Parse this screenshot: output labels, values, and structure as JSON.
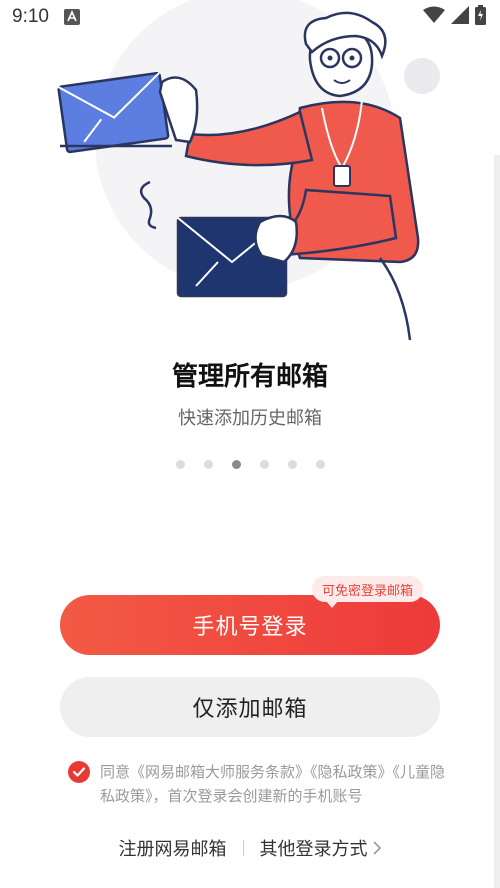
{
  "status_bar": {
    "time": "9:10",
    "icons": [
      "app-notification-icon",
      "wifi-icon",
      "signal-icon",
      "battery-icon"
    ]
  },
  "illustration": {
    "description_icon": "person-holding-envelopes-illustration",
    "colors": {
      "shirt": "#ef5a4c",
      "envelope_front": "#5b7ee0",
      "envelope_back": "#1f3570",
      "skin": "#ffffff"
    }
  },
  "onboarding": {
    "title": "管理所有邮箱",
    "subtitle": "快速添加历史邮箱",
    "page_count": 6,
    "active_page": 3
  },
  "actions": {
    "phone_login_label": "手机号登录",
    "tip_badge": "可免密登录邮箱",
    "add_mailbox_label": "仅添加邮箱"
  },
  "agreement": {
    "checked": true,
    "text": "同意《网易邮箱大师服务条款》《隐私政策》《儿童隐私政策》，首次登录会创建新的手机账号"
  },
  "footer": {
    "register_label": "注册网易邮箱",
    "other_login_label": "其他登录方式"
  },
  "colors": {
    "accent": "#ee3a3a",
    "accent_start": "#f25a45",
    "secondary_bg": "#efefef"
  }
}
